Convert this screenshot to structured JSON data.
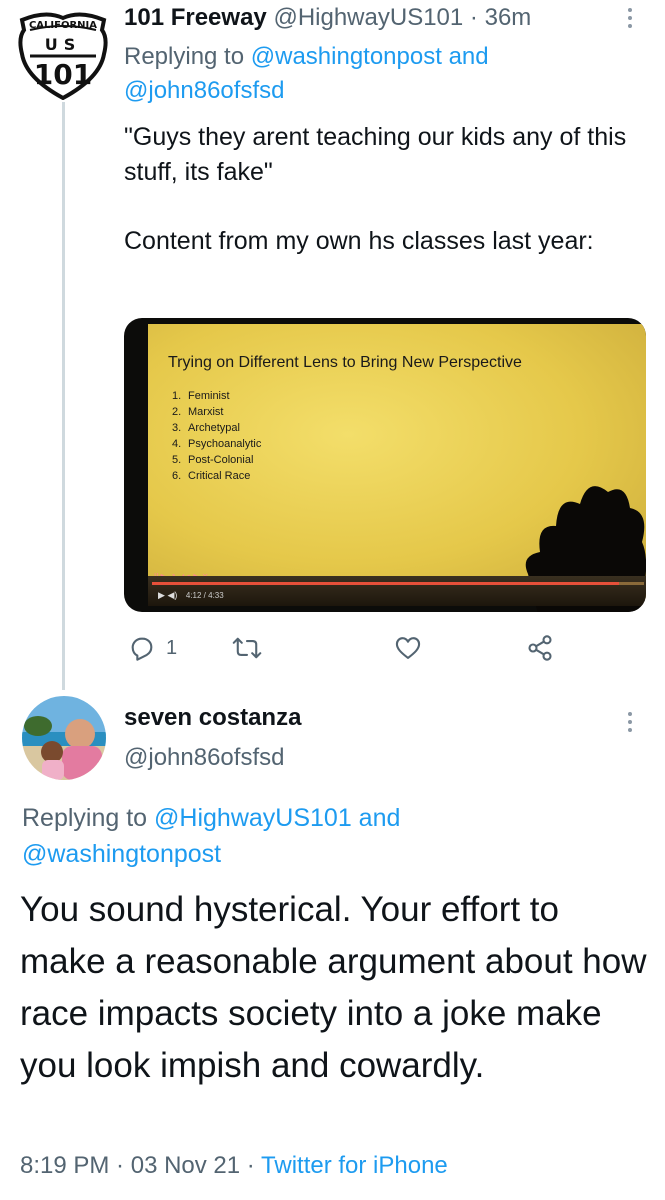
{
  "tweet1": {
    "avatar": {
      "state_text": "CALIFORNIA",
      "us_text": "US",
      "number": "101"
    },
    "display_name": "101 Freeway",
    "handle": "@HighwayUS101",
    "separator": "·",
    "time": "36m",
    "replying_prefix": "Replying to ",
    "replying_handle1": "@washingtonpost",
    "replying_and": " and",
    "replying_handle2": "@john86ofsfsd",
    "text_p1": "\"Guys they arent teaching our kids any of this stuff, its fake\"",
    "text_p2": "Content from my own hs classes last year:",
    "media": {
      "slide_title": "Trying on Different Lens to Bring New Perspective",
      "list": [
        {
          "num": "1.",
          "label": "Feminist"
        },
        {
          "num": "2.",
          "label": "Marxist"
        },
        {
          "num": "3.",
          "label": "Archetypal"
        },
        {
          "num": "4.",
          "label": "Psychoanalytic"
        },
        {
          "num": "5.",
          "label": "Post-Colonial"
        },
        {
          "num": "6.",
          "label": "Critical Race"
        }
      ],
      "video_time": "4:12 / 4:33",
      "progress_fraction": 0.95
    },
    "reply_count": "1",
    "icons": {
      "reply": "reply-icon",
      "retweet": "retweet-icon",
      "like": "heart-icon",
      "share": "share-icon",
      "more": "more-icon"
    }
  },
  "tweet2": {
    "display_name": "seven costanza",
    "handle": "@john86ofsfsd",
    "replying_prefix": "Replying to ",
    "replying_handle1": "@HighwayUS101",
    "replying_and": " and",
    "replying_handle2": "@washingtonpost",
    "text": "You sound hysterical. Your effort to make a reasonable argument about how race impacts society into a joke make you look impish and cowardly.",
    "time": "8:19 PM",
    "separator": " · ",
    "date": "03 Nov 21",
    "separator2": " · ",
    "source": "Twitter for iPhone"
  },
  "colors": {
    "accent": "#1d9bf0",
    "secondary_text": "#536471",
    "primary_text": "#0f1419",
    "thread_line": "#cfd9de"
  }
}
